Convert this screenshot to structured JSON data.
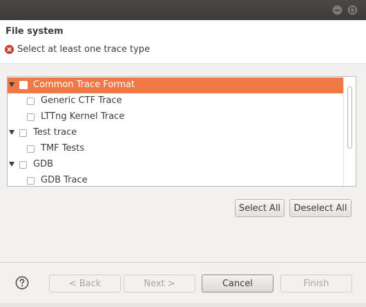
{
  "header": {
    "title": "File system",
    "error_message": "Select at least one trace type",
    "error_icon": "error-icon"
  },
  "colors": {
    "selection": "#f07746",
    "titlebar": "#3c3b37",
    "body_bg": "#f2f1f0"
  },
  "tree": {
    "items": [
      {
        "label": "Common Trace Format",
        "level": 0,
        "expanded": true,
        "selected": true,
        "checked": false
      },
      {
        "label": "Generic CTF Trace",
        "level": 1,
        "checked": false
      },
      {
        "label": "LTTng Kernel Trace",
        "level": 1,
        "checked": false
      },
      {
        "label": "Test trace",
        "level": 0,
        "expanded": true,
        "checked": false
      },
      {
        "label": "TMF Tests",
        "level": 1,
        "checked": false
      },
      {
        "label": "GDB",
        "level": 0,
        "expanded": true,
        "checked": false
      },
      {
        "label": "GDB Trace",
        "level": 1,
        "checked": false
      }
    ]
  },
  "actions": {
    "select_all": "Select All",
    "deselect_all": "Deselect All"
  },
  "footer": {
    "back": "< Back",
    "next": "Next >",
    "cancel": "Cancel",
    "finish": "Finish",
    "help_icon": "help-icon"
  }
}
